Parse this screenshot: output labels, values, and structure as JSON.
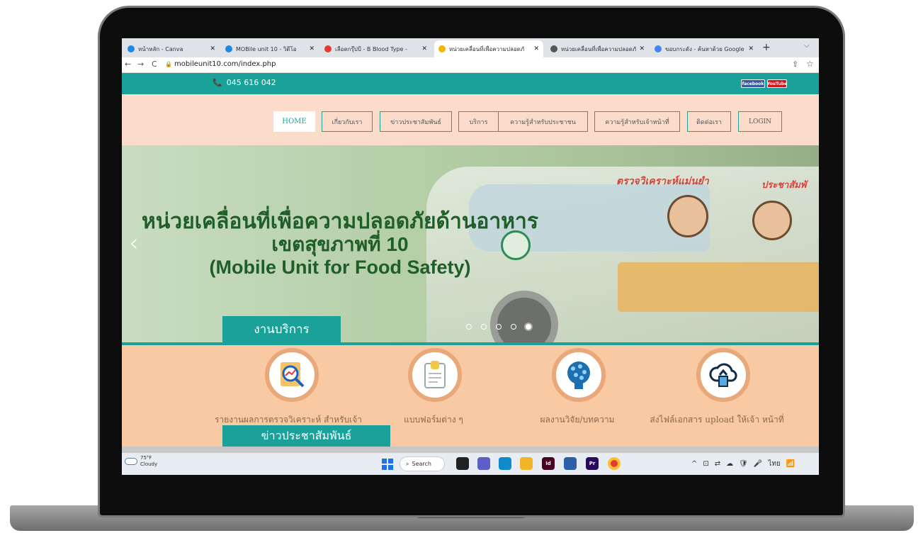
{
  "browser": {
    "tabs": [
      {
        "label": "หน้าหลัก - Canva",
        "fav_color": "#1e88e5"
      },
      {
        "label": "MOBile unit 10 - วิดีโอ",
        "fav_color": "#1e88e5"
      },
      {
        "label": "เลือดกรุ๊ปบี - B Blood Type - ",
        "fav_color": "#e53935"
      },
      {
        "label": "หน่วยเคลื่อนที่เพื่อความปลอดภั",
        "fav_color": "#f4b400"
      },
      {
        "label": "หน่วยเคลื่อนที่เพื่อความปลอดภั",
        "fav_color": "#555555"
      },
      {
        "label": "ขอบกระดัง - ค้นหาด้วย Google",
        "fav_color": "#4285f4"
      }
    ],
    "active_tab": 3,
    "new_tab": "+",
    "tab_menu": "⌵",
    "close_symbol": "✕",
    "nav_back": "←",
    "nav_forward": "→",
    "nav_reload": "C",
    "lock": "🔒",
    "url": "mobileunit10.com/index.php",
    "share_icon": "⇪",
    "star_icon": "☆"
  },
  "site": {
    "phone_icon": "📞",
    "phone": "045 616 042",
    "facebook": "facebook",
    "youtube": "YouTube",
    "menu": [
      "HOME",
      "เกี่ยวกับเรา",
      "ข่าวประชาสัมพันธ์",
      "บริการ",
      "ความรู้สำหรับประชาชน",
      "ความรู้สำหรับเจ้าหน้าที่",
      "ติดต่อเรา",
      "LOGIN"
    ],
    "hero": {
      "tag1": "ตรวจวิเคราะห์แม่นยำ",
      "tag2": "ประชาสัมพั",
      "line1": "หน่วยเคลื่อนที่เพื่อความปลอดภัยด้านอาหาร",
      "line2": "เขตสุขภาพที่ 10",
      "line3": "(Mobile Unit for Food Safety)",
      "prev": "‹",
      "slides": 5,
      "active_slide": 4
    },
    "services_heading": "งานบริการ",
    "services": [
      {
        "icon": "report-analysis-icon",
        "label": "รายงานผลการตรวจวิเคราะห์ สำหรับเจ้าหน้าที่"
      },
      {
        "icon": "form-document-icon",
        "label": "แบบฟอร์มต่าง ๆ"
      },
      {
        "icon": "research-brain-icon",
        "label": "ผลงานวิจัย/บทความ"
      },
      {
        "icon": "cloud-upload-icon",
        "label": "ส่งไฟล์เอกสาร upload ให้เจ้า หน้าที่"
      }
    ],
    "news_heading": "ข่าวประชาสัมพันธ์"
  },
  "taskbar": {
    "temp": "75°F",
    "condition": "Cloudy",
    "search": "Search",
    "search_icon": "⌕",
    "apps": [
      {
        "name": "file-explorer",
        "color": "#222222",
        "text": ""
      },
      {
        "name": "chat",
        "color": "#5b5fc7",
        "text": ""
      },
      {
        "name": "edge",
        "color": "#0f8bc9",
        "text": ""
      },
      {
        "name": "folder",
        "color": "#f2b428",
        "text": ""
      },
      {
        "name": "indesign",
        "color": "#49021f",
        "text": "Id"
      },
      {
        "name": "app-blue",
        "color": "#2d5ea8",
        "text": ""
      },
      {
        "name": "premiere",
        "color": "#2a0a5e",
        "text": "Pr"
      },
      {
        "name": "chrome",
        "color": "#e53935",
        "text": ""
      }
    ],
    "tray": [
      "^",
      "⊡",
      "⇄",
      "☁",
      "🛡",
      "🎤",
      "ไทย",
      "📶"
    ]
  }
}
